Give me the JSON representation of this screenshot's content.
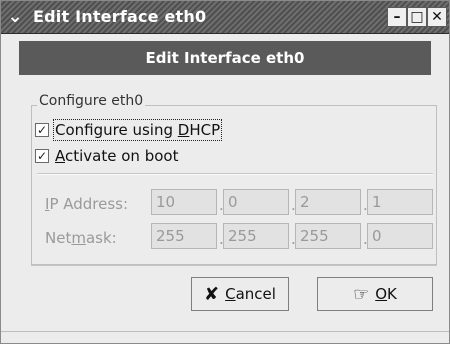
{
  "window": {
    "title": "Edit Interface eth0",
    "controls": {
      "menu_icon": "chevron-down-icon",
      "minimize_icon": "minimize-icon",
      "maximize_icon": "maximize-icon",
      "close_icon": "close-icon"
    }
  },
  "header": {
    "title": "Edit Interface eth0"
  },
  "group": {
    "legend": "Configure eth0",
    "dhcp": {
      "label_before": "Configure using ",
      "mnemonic": "D",
      "label_after": "HCP",
      "checked": true
    },
    "boot": {
      "mnemonic": "A",
      "label_after": "ctivate on boot",
      "checked": true
    },
    "ip": {
      "label_mnemonic": "I",
      "label_after": "P Address:",
      "octets": [
        "10",
        "0",
        "2",
        "1"
      ]
    },
    "netmask": {
      "label_before": "Net",
      "label_mnemonic": "m",
      "label_after": "ask:",
      "octets": [
        "255",
        "255",
        "255",
        "0"
      ]
    }
  },
  "buttons": {
    "cancel": {
      "icon": "cancel-icon",
      "mnemonic": "C",
      "label_after": "ancel"
    },
    "ok": {
      "icon": "ok-icon",
      "mnemonic": "O",
      "label_after": "K"
    }
  }
}
